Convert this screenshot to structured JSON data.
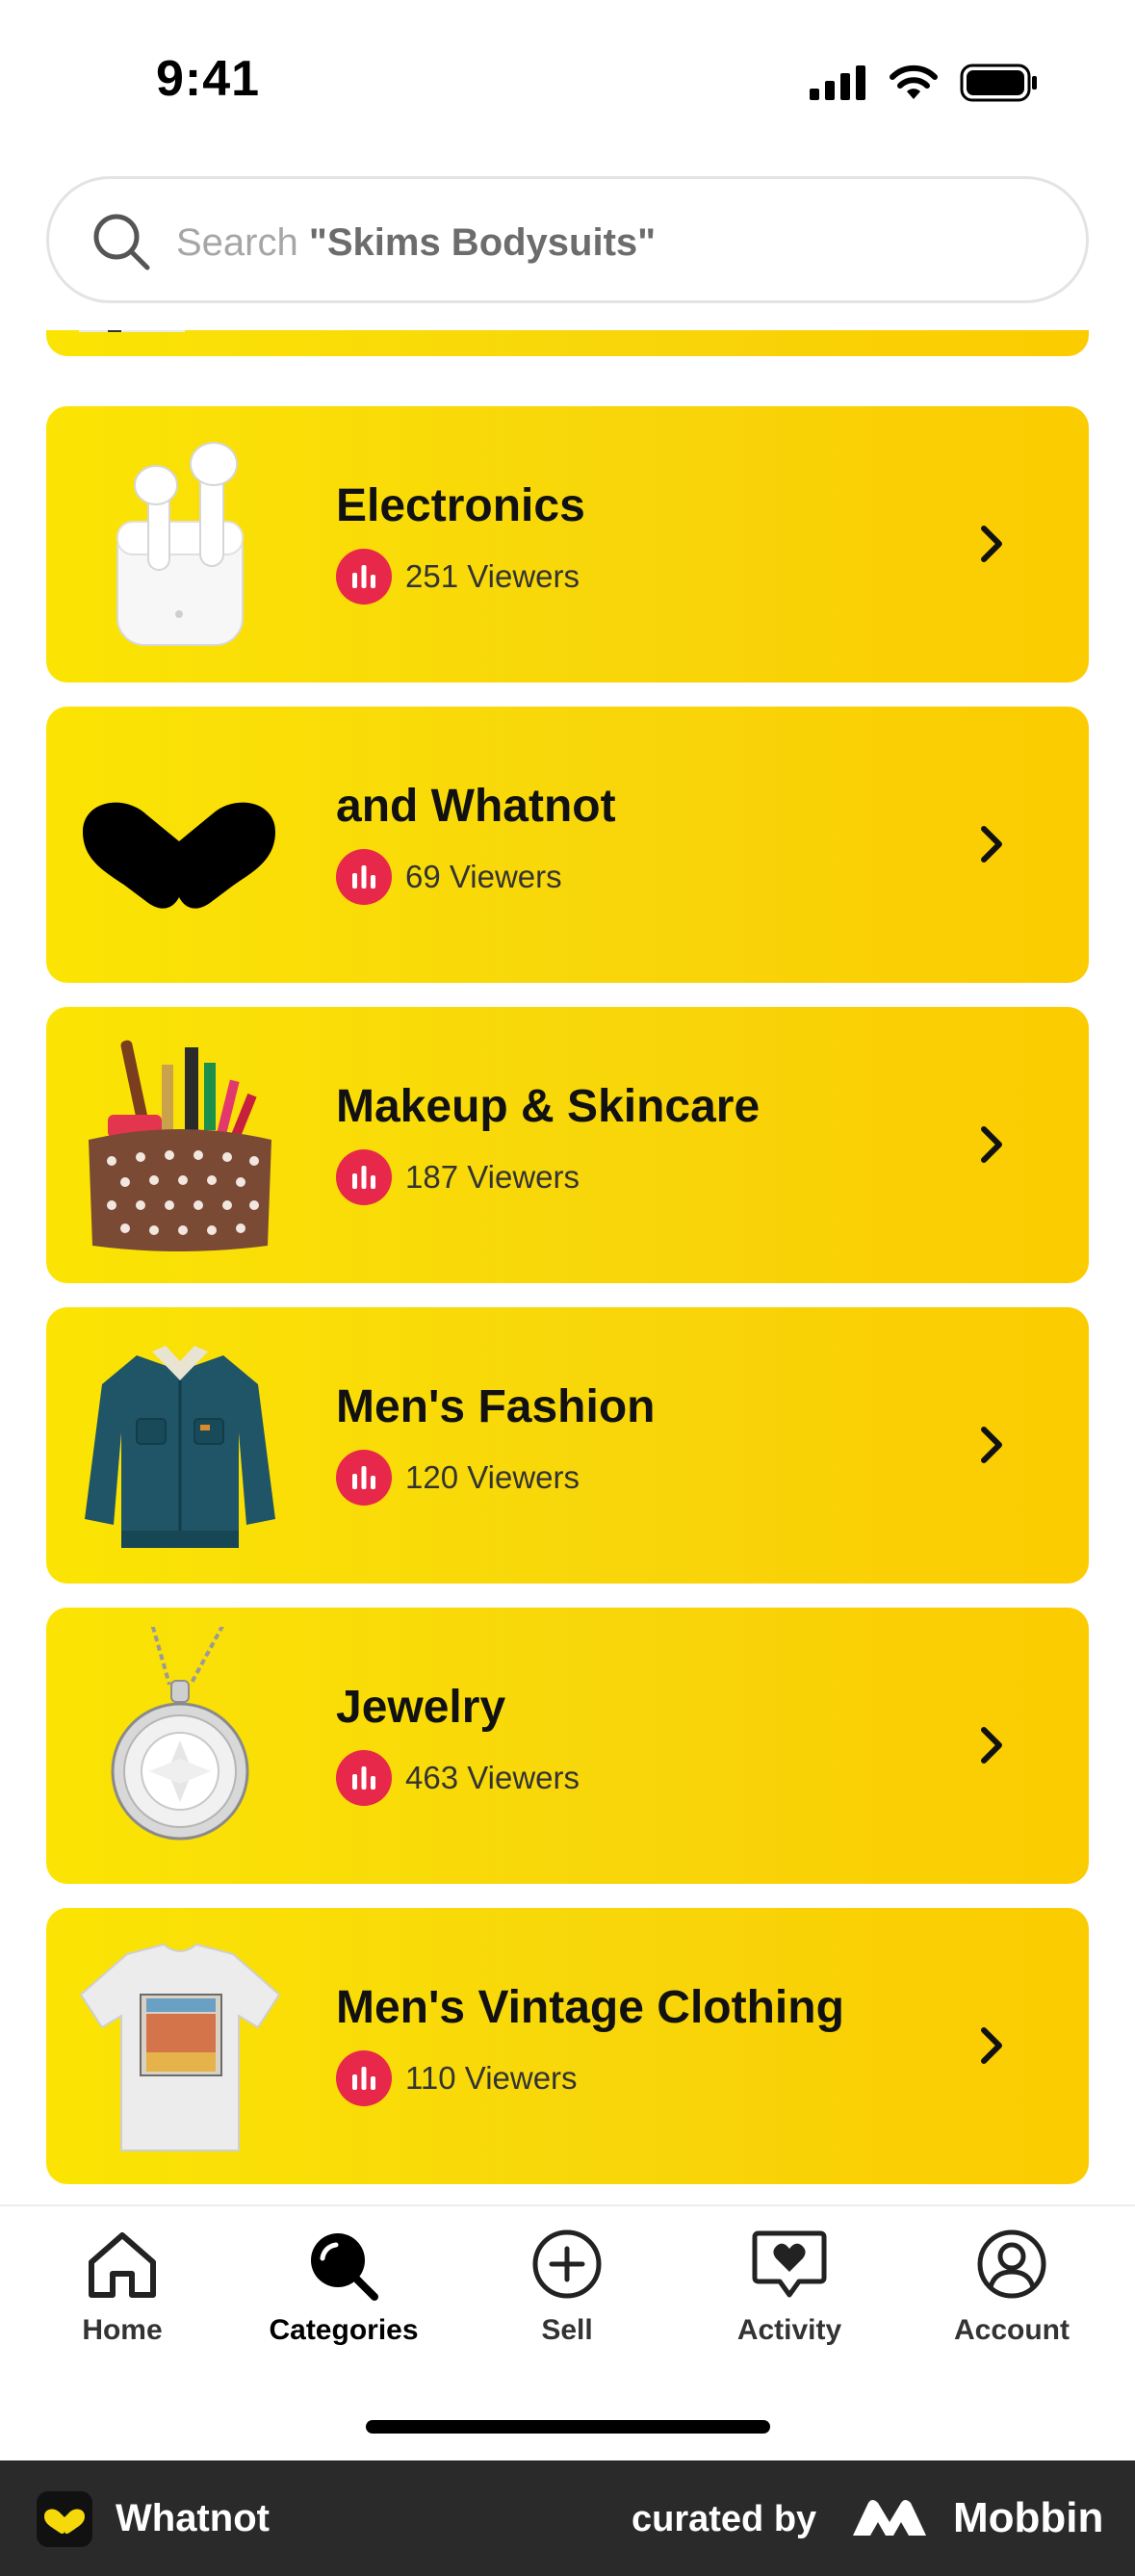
{
  "status_bar": {
    "time": "9:41"
  },
  "search": {
    "prefix": "Search",
    "query": "\"Skims Bodysuits\""
  },
  "categories": [
    {
      "title": "Electronics",
      "viewers": "251 Viewers",
      "icon": "earbuds-image"
    },
    {
      "title": "and Whatnot",
      "viewers": "69 Viewers",
      "icon": "whatnot-logo-image"
    },
    {
      "title": "Makeup & Skincare",
      "viewers": "187 Viewers",
      "icon": "makeup-bag-image"
    },
    {
      "title": "Men's Fashion",
      "viewers": "120 Viewers",
      "icon": "denim-jacket-image"
    },
    {
      "title": "Jewelry",
      "viewers": "463 Viewers",
      "icon": "pendant-necklace-image"
    },
    {
      "title": "Men's Vintage Clothing",
      "viewers": "110 Viewers",
      "icon": "vintage-tshirt-image"
    }
  ],
  "tabs": [
    {
      "label": "Home",
      "icon": "home-icon"
    },
    {
      "label": "Categories",
      "icon": "categories-icon",
      "active": true
    },
    {
      "label": "Sell",
      "icon": "plus-circle-icon"
    },
    {
      "label": "Activity",
      "icon": "heart-chat-icon"
    },
    {
      "label": "Account",
      "icon": "account-icon"
    }
  ],
  "banner": {
    "app_name": "Whatnot",
    "curated_by": "curated by",
    "brand": "Mobbin"
  },
  "colors": {
    "card_yellow": "#fbe404",
    "live_red": "#e8284a",
    "text_dark": "#111111"
  }
}
